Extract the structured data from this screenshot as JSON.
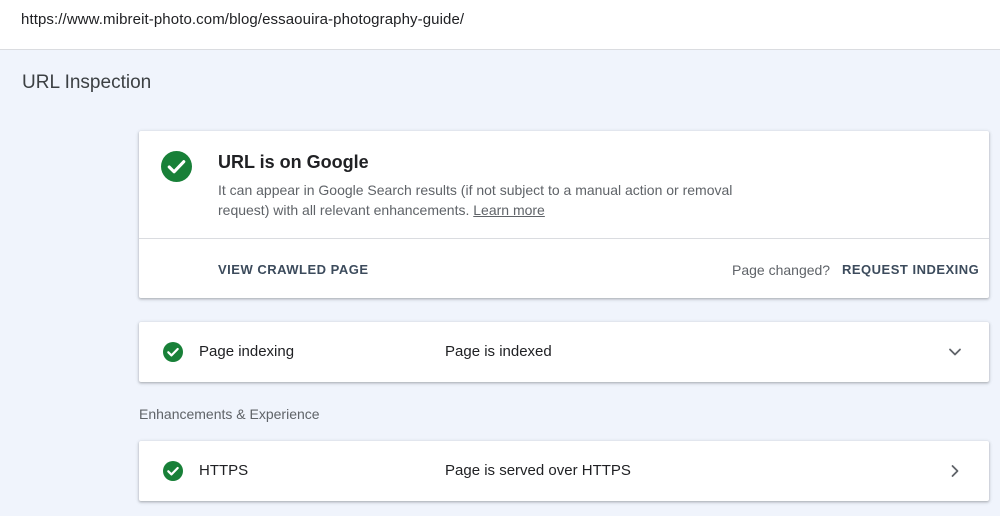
{
  "address_bar": {
    "url": "https://www.mibreit-photo.com/blog/essaouira-photography-guide/"
  },
  "page": {
    "title": "URL Inspection"
  },
  "status_card": {
    "title": "URL is on Google",
    "description": "It can appear in Google Search results (if not subject to a manual action or removal request) with all relevant enhancements.",
    "learn_more": "Learn more",
    "view_crawled_label": "VIEW CRAWLED PAGE",
    "page_changed_label": "Page changed?",
    "request_indexing_label": "REQUEST INDEXING",
    "status_icon": "check-circle-icon",
    "status_color": "#188038"
  },
  "indexing_row": {
    "label": "Page indexing",
    "status": "Page is indexed",
    "icon": "check-circle-icon",
    "action_icon": "chevron-down-icon"
  },
  "enhancements": {
    "section_label": "Enhancements & Experience",
    "items": [
      {
        "label": "HTTPS",
        "status": "Page is served over HTTPS",
        "icon": "check-circle-icon",
        "action_icon": "chevron-right-icon"
      }
    ]
  }
}
